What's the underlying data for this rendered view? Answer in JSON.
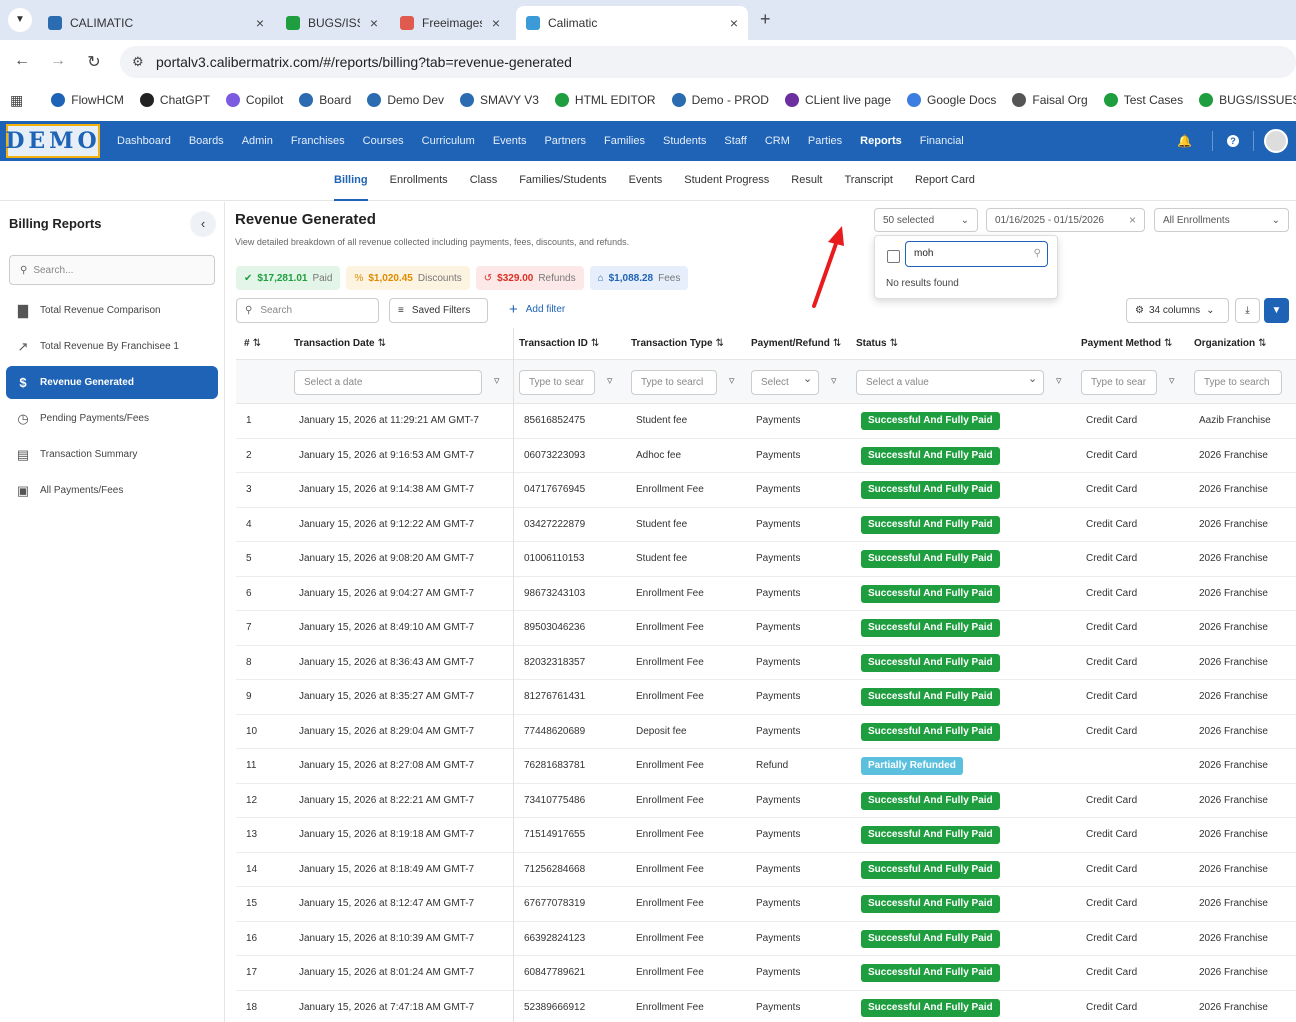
{
  "browser": {
    "tabs": [
      {
        "title": "CALIMATIC",
        "color": "#2b6cb0"
      },
      {
        "title": "BUGS/ISSUES",
        "color": "#1e9e3e"
      },
      {
        "title": "Freeimages",
        "color": "#e05a4f"
      },
      {
        "title": "Calimatic",
        "color": "#3b9bd8"
      }
    ],
    "new_tab": "+",
    "url": "portalv3.calibermatrix.com/#/reports/billing?tab=revenue-generated",
    "bookmarks": [
      {
        "label": "FlowHCM",
        "color": "#1e63b5"
      },
      {
        "label": "ChatGPT",
        "color": "#222222"
      },
      {
        "label": "Copilot",
        "color": "#7b5ce0"
      },
      {
        "label": "Board",
        "color": "#2b6cb0"
      },
      {
        "label": "Demo Dev",
        "color": "#2b6cb0"
      },
      {
        "label": "SMAVY V3",
        "color": "#2b6cb0"
      },
      {
        "label": "HTML EDITOR",
        "color": "#1e9e3e"
      },
      {
        "label": "Demo - PROD",
        "color": "#2b6cb0"
      },
      {
        "label": "CLient live page",
        "color": "#6b2fa0"
      },
      {
        "label": "Google Docs",
        "color": "#3b7de0"
      },
      {
        "label": "Faisal Org",
        "color": "#555555"
      },
      {
        "label": "Test Cases",
        "color": "#1e9e3e"
      },
      {
        "label": "BUGS/ISSUES",
        "color": "#1e9e3e"
      }
    ]
  },
  "app": {
    "logo": "DEMO",
    "nav": [
      "Dashboard",
      "Boards",
      "Admin",
      "Franchises",
      "Courses",
      "Curriculum",
      "Events",
      "Partners",
      "Families",
      "Students",
      "Staff",
      "CRM",
      "Parties",
      "Reports",
      "Financial"
    ],
    "nav_active": "Reports",
    "subnav": [
      "Billing",
      "Enrollments",
      "Class",
      "Families/Students",
      "Events",
      "Student Progress",
      "Result",
      "Transcript",
      "Report Card"
    ],
    "subnav_active": "Billing"
  },
  "sidebar": {
    "title": "Billing Reports",
    "search_placeholder": "Search...",
    "items": [
      {
        "label": "Total Revenue Comparison",
        "icon": "bar-chart-icon"
      },
      {
        "label": "Total Revenue By Franchisee 1",
        "icon": "line-chart-icon"
      },
      {
        "label": "Revenue Generated",
        "icon": "dollar-icon",
        "active": true
      },
      {
        "label": "Pending Payments/Fees",
        "icon": "clock-icon"
      },
      {
        "label": "Transaction Summary",
        "icon": "receipt-icon"
      },
      {
        "label": "All Payments/Fees",
        "icon": "credit-card-icon"
      }
    ]
  },
  "main": {
    "title": "Revenue Generated",
    "subtitle": "View detailed breakdown of all revenue collected including payments, fees, discounts, and refunds.",
    "franchise_select": "50 selected",
    "date_range": "01/16/2025 - 01/15/2026",
    "enrollment_select": "All Enrollments",
    "dropdown": {
      "search_value": "moh",
      "empty_text": "No results found"
    },
    "summary": [
      {
        "amount": "$17,281.01",
        "label": "Paid",
        "bg": "#e3f5e8",
        "color": "#1e9e3e",
        "icon": "✔"
      },
      {
        "amount": "$1,020.45",
        "label": "Discounts",
        "bg": "#fdf3e1",
        "color": "#e08a00",
        "icon": "%"
      },
      {
        "amount": "$329.00",
        "label": "Refunds",
        "bg": "#fde8e8",
        "color": "#d93025",
        "icon": "↺"
      },
      {
        "amount": "$1,088.28",
        "label": "Fees",
        "bg": "#e6eefb",
        "color": "#1e63b5",
        "icon": "⌂"
      }
    ],
    "search_placeholder": "Search",
    "saved_filters": "Saved Filters",
    "add_filter": "Add filter",
    "columns_btn": "34 columns"
  },
  "table": {
    "columns": [
      "#",
      "Transaction Date",
      "Transaction ID",
      "Transaction Type",
      "Payment/Refund",
      "Status",
      "Payment Method",
      "Organization"
    ],
    "filters": [
      "",
      "Select a date",
      "Type to sear",
      "Type to searcl",
      "Select",
      "Select a value",
      "Type to sear",
      "Type to search"
    ],
    "rows": [
      [
        "1",
        "January 15, 2026 at 11:29:21 AM GMT-7",
        "85616852475",
        "Student fee",
        "Payments",
        "Successful And Fully Paid",
        "Credit Card",
        "Aazib Franchise"
      ],
      [
        "2",
        "January 15, 2026 at 9:16:53 AM GMT-7",
        "06073223093",
        "Adhoc fee",
        "Payments",
        "Successful And Fully Paid",
        "Credit Card",
        "2026 Franchise"
      ],
      [
        "3",
        "January 15, 2026 at 9:14:38 AM GMT-7",
        "04717676945",
        "Enrollment Fee",
        "Payments",
        "Successful And Fully Paid",
        "Credit Card",
        "2026 Franchise"
      ],
      [
        "4",
        "January 15, 2026 at 9:12:22 AM GMT-7",
        "03427222879",
        "Student fee",
        "Payments",
        "Successful And Fully Paid",
        "Credit Card",
        "2026 Franchise"
      ],
      [
        "5",
        "January 15, 2026 at 9:08:20 AM GMT-7",
        "01006110153",
        "Student fee",
        "Payments",
        "Successful And Fully Paid",
        "Credit Card",
        "2026 Franchise"
      ],
      [
        "6",
        "January 15, 2026 at 9:04:27 AM GMT-7",
        "98673243103",
        "Enrollment Fee",
        "Payments",
        "Successful And Fully Paid",
        "Credit Card",
        "2026 Franchise"
      ],
      [
        "7",
        "January 15, 2026 at 8:49:10 AM GMT-7",
        "89503046236",
        "Enrollment Fee",
        "Payments",
        "Successful And Fully Paid",
        "Credit Card",
        "2026 Franchise"
      ],
      [
        "8",
        "January 15, 2026 at 8:36:43 AM GMT-7",
        "82032318357",
        "Enrollment Fee",
        "Payments",
        "Successful And Fully Paid",
        "Credit Card",
        "2026 Franchise"
      ],
      [
        "9",
        "January 15, 2026 at 8:35:27 AM GMT-7",
        "81276761431",
        "Enrollment Fee",
        "Payments",
        "Successful And Fully Paid",
        "Credit Card",
        "2026 Franchise"
      ],
      [
        "10",
        "January 15, 2026 at 8:29:04 AM GMT-7",
        "77448620689",
        "Deposit fee",
        "Payments",
        "Successful And Fully Paid",
        "Credit Card",
        "2026 Franchise"
      ],
      [
        "11",
        "January 15, 2026 at 8:27:08 AM GMT-7",
        "76281683781",
        "Enrollment Fee",
        "Refund",
        "Partially Refunded",
        "",
        "2026 Franchise"
      ],
      [
        "12",
        "January 15, 2026 at 8:22:21 AM GMT-7",
        "73410775486",
        "Enrollment Fee",
        "Payments",
        "Successful And Fully Paid",
        "Credit Card",
        "2026 Franchise"
      ],
      [
        "13",
        "January 15, 2026 at 8:19:18 AM GMT-7",
        "71514917655",
        "Enrollment Fee",
        "Payments",
        "Successful And Fully Paid",
        "Credit Card",
        "2026 Franchise"
      ],
      [
        "14",
        "January 15, 2026 at 8:18:49 AM GMT-7",
        "71256284668",
        "Enrollment Fee",
        "Payments",
        "Successful And Fully Paid",
        "Credit Card",
        "2026 Franchise"
      ],
      [
        "15",
        "January 15, 2026 at 8:12:47 AM GMT-7",
        "67677078319",
        "Enrollment Fee",
        "Payments",
        "Successful And Fully Paid",
        "Credit Card",
        "2026 Franchise"
      ],
      [
        "16",
        "January 15, 2026 at 8:10:39 AM GMT-7",
        "66392824123",
        "Enrollment Fee",
        "Payments",
        "Successful And Fully Paid",
        "Credit Card",
        "2026 Franchise"
      ],
      [
        "17",
        "January 15, 2026 at 8:01:24 AM GMT-7",
        "60847789621",
        "Enrollment Fee",
        "Payments",
        "Successful And Fully Paid",
        "Credit Card",
        "2026 Franchise"
      ],
      [
        "18",
        "January 15, 2026 at 7:47:18 AM GMT-7",
        "52389666912",
        "Enrollment Fee",
        "Payments",
        "Successful And Fully Paid",
        "Credit Card",
        "2026 Franchise"
      ]
    ]
  }
}
